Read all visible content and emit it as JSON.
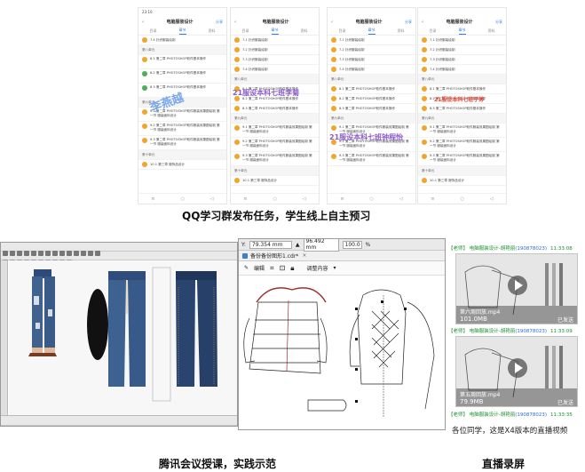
{
  "captions": {
    "top": "QQ学习群发布任务，学生线上自主预习",
    "bottom_left": "腾讯会议授课，实践示范",
    "bottom_right": "直播录屏"
  },
  "phones": [
    {
      "title": "电脑服装设计",
      "share": "分享",
      "time": "23:10",
      "tabs": [
        "目录",
        "章节",
        "资料"
      ],
      "rows": [
        {
          "text": "7.4 针织服装绘制",
          "type": "item"
        },
        {
          "text": "第八单元",
          "type": "section"
        },
        {
          "text": "8.1 第二章 PHOTOSHOP软件基本操作",
          "type": "tall"
        },
        {
          "text": "8.2 第二章 PHOTOSHOP软件基本操作",
          "type": "tall"
        },
        {
          "text": "8.3 第二章 PHOTOSHOP软件基本操作",
          "type": "tall"
        },
        {
          "text": "第九单元",
          "type": "section"
        },
        {
          "text": "9.1 第二章 PHOTOSHOP软件服装效果图绘制 第一节 服装面料设计",
          "type": "tall"
        },
        {
          "text": "9.2 第二章 PHOTOSHOP软件服装效果图绘制 第一节 服装面料设计",
          "type": "tall"
        },
        {
          "text": "9.3 第二章 PHOTOSHOP软件服装效果图绘制 第一节 服装面料设计",
          "type": "tall"
        },
        {
          "text": "第十单元",
          "type": "section"
        },
        {
          "text": "10.1 第三章 服饰品设计",
          "type": "item"
        }
      ],
      "watermark": "李燕越"
    },
    {
      "title": "电脑服装设计",
      "share": "",
      "time": "",
      "tabs": [
        "目录",
        "章节",
        "资料"
      ],
      "rows": [
        {
          "text": "7.1 针织服装绘制",
          "type": "item"
        },
        {
          "text": "7.2 针织服装绘制",
          "type": "item"
        },
        {
          "text": "7.3 针织服装绘制",
          "type": "item"
        },
        {
          "text": "7.4 针织服装绘制",
          "type": "item"
        },
        {
          "text": "第八单元",
          "type": "section"
        },
        {
          "text": "8.1 第二章 PHOTOSHOP软件基本操作",
          "type": "item"
        },
        {
          "text": "8.2 第二章 PHOTOSHOP软件基本操作",
          "type": "item"
        },
        {
          "text": "8.3 第二章 PHOTOSHOP软件基本操作",
          "type": "item"
        },
        {
          "text": "第九单元",
          "type": "section"
        },
        {
          "text": "9.1 第二章 PHOTOSHOP软件服装效果图绘制 第一节 服装面料设计",
          "type": "tall"
        },
        {
          "text": "9.2 第二章 PHOTOSHOP软件服装效果图绘制 第一节 服装面料设计",
          "type": "tall"
        },
        {
          "text": "9.3 第二章 PHOTOSHOP软件服装效果图绘制 第一节 服装面料设计",
          "type": "tall"
        },
        {
          "text": "第十单元",
          "type": "section"
        },
        {
          "text": "10.1 第三章 服饰品设计",
          "type": "item"
        }
      ],
      "watermark": "21服设本科七班李菊"
    },
    {
      "title": "电脑服装设计",
      "share": "分享",
      "time": "",
      "tabs": [
        "目录",
        "章节",
        "资料"
      ],
      "rows": [
        {
          "text": "7.1 针织服装绘制",
          "type": "item"
        },
        {
          "text": "7.2 针织服装绘制",
          "type": "item"
        },
        {
          "text": "7.3 针织服装绘制",
          "type": "item"
        },
        {
          "text": "7.4 针织服装绘制",
          "type": "item"
        },
        {
          "text": "第八单元",
          "type": "section"
        },
        {
          "text": "8.1 第二章 PHOTOSHOP软件基本操作",
          "type": "item"
        },
        {
          "text": "8.2 第二章 PHOTOSHOP软件基本操作",
          "type": "item"
        },
        {
          "text": "8.3 第二章 PHOTOSHOP软件基本操作",
          "type": "item"
        },
        {
          "text": "第九单元",
          "type": "section"
        },
        {
          "text": "9.1 第二章 PHOTOSHOP软件服装效果图绘制 第一节 服装面料设计",
          "type": "tall"
        },
        {
          "text": "9.2 第二章 PHOTOSHOP软件服装效果图绘制 第一节 服装面料设计",
          "type": "tall"
        },
        {
          "text": "9.3 第二章 PHOTOSHOP软件服装效果图绘制 第一节 服装面料设计",
          "type": "tall"
        }
      ],
      "watermark": "21服设本科七班钟程怡"
    },
    {
      "title": "电脑服装设计",
      "share": "分享",
      "time": "",
      "tabs": [
        "目录",
        "章节",
        "资料"
      ],
      "rows": [
        {
          "text": "7.1 针织服装绘制",
          "type": "item"
        },
        {
          "text": "7.2 针织服装绘制",
          "type": "item"
        },
        {
          "text": "7.3 针织服装绘制",
          "type": "item"
        },
        {
          "text": "7.4 针织服装绘制",
          "type": "item"
        },
        {
          "text": "第八单元",
          "type": "section"
        },
        {
          "text": "8.1 第二章 PHOTOSHOP软件基本操作",
          "type": "item"
        },
        {
          "text": "8.2 第二章 PHOTOSHOP软件基本操作",
          "type": "item"
        },
        {
          "text": "8.3 第二章 PHOTOSHOP软件基本操作",
          "type": "item"
        },
        {
          "text": "第九单元",
          "type": "section"
        },
        {
          "text": "9.1 第二章 PHOTOSHOP软件服装效果图绘制 第一节 服装面料设计",
          "type": "tall"
        },
        {
          "text": "9.2 第二章 PHOTOSHOP软件服装效果图绘制 第一节 服装面料设计",
          "type": "tall"
        },
        {
          "text": "9.3 第二章 PHOTOSHOP软件服装效果图绘制 第一节 服装面料设计",
          "type": "tall"
        },
        {
          "text": "第十单元",
          "type": "section"
        },
        {
          "text": "10.1 第三章 服饰品设计",
          "type": "item"
        }
      ],
      "watermark": "21服设本科七班于婷"
    }
  ],
  "coreldraw": {
    "x_field": "79.354 mm",
    "y_field": "96.492 mm",
    "pct1": "100.0",
    "pct2": "%",
    "doc_tab": "备份备份图形1.cdr*",
    "edit_label": "编辑",
    "adjust_label": "调整内容"
  },
  "chat": [
    {
      "sender": "【老师】 电脑服装设计-胡艳丽",
      "qq": "(190878023)",
      "time": "11:33:08",
      "file": "第六周回放.mp4",
      "size": "101.0MB",
      "status": "已发送"
    },
    {
      "sender": "【老师】 电脑服装设计-胡艳丽",
      "qq": "(190878023)",
      "time": "11:33:09",
      "file": "第五周回放.mp4",
      "size": "79.9MB",
      "status": "已发送"
    },
    {
      "sender": "【老师】 电脑服装设计-胡艳丽",
      "qq": "(190878023)",
      "time": "11:33:35",
      "message": "各位同学，这是X4版本的直播视频"
    }
  ],
  "colors": {
    "accent": "#2b7de9",
    "orange": "#f3a42a",
    "qq_green": "#1a8e2e",
    "watermark_purple": "#8a5cc9"
  }
}
